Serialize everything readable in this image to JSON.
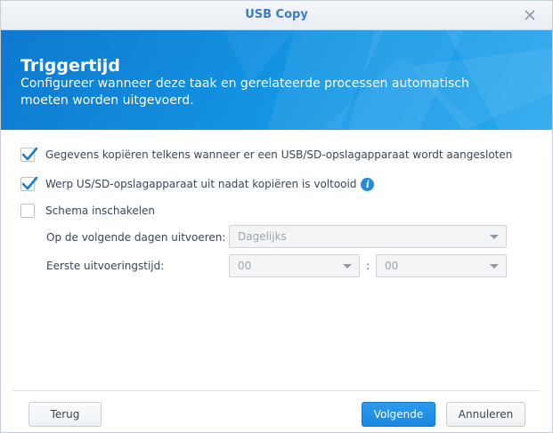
{
  "window": {
    "title": "USB Copy"
  },
  "banner": {
    "title": "Triggertijd",
    "description": "Configureer wanneer deze taak en gerelateerde processen automatisch moeten worden uitgevoerd."
  },
  "options": [
    {
      "label": "Gegevens kopiëren telkens wanneer er een USB/SD-opslagapparaat wordt aangesloten",
      "checked": true
    },
    {
      "label": "Werp US/SD-opslagapparaat uit nadat kopiëren is voltooid",
      "checked": true
    },
    {
      "label": "Schema inschakelen",
      "checked": false
    }
  ],
  "schedule": {
    "days_label": "Op de volgende dagen uitvoeren:",
    "days_value": "Dagelijks",
    "time_label": "Eerste uitvoeringstijd:",
    "hour_value": "00",
    "separator": ":",
    "minute_value": "00"
  },
  "footer": {
    "back_label": "Terug",
    "next_label": "Volgende",
    "cancel_label": "Annuleren"
  },
  "colors": {
    "accent": "#1a86dd",
    "banner": "#1596e4",
    "check": "#1f7bd1",
    "title": "#3b7cc3"
  }
}
